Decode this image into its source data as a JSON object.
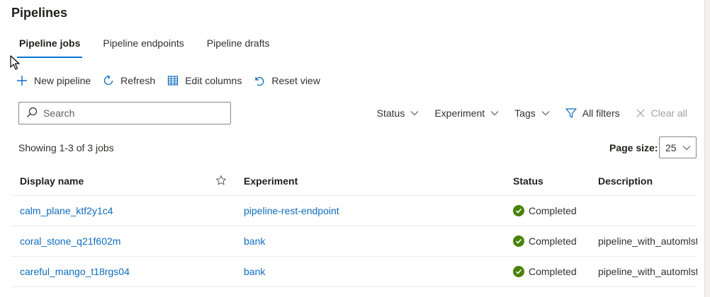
{
  "page": {
    "title": "Pipelines"
  },
  "tabs": [
    {
      "label": "Pipeline jobs",
      "active": true
    },
    {
      "label": "Pipeline endpoints",
      "active": false
    },
    {
      "label": "Pipeline drafts",
      "active": false
    }
  ],
  "toolbar": {
    "new_pipeline": "New pipeline",
    "refresh": "Refresh",
    "edit_columns": "Edit columns",
    "reset_view": "Reset view"
  },
  "search": {
    "placeholder": "Search",
    "value": ""
  },
  "filters": {
    "status": "Status",
    "experiment": "Experiment",
    "tags": "Tags",
    "all_filters": "All filters",
    "clear_all": "Clear all"
  },
  "summary": {
    "showing": "Showing 1-3 of 3 jobs"
  },
  "page_size": {
    "label": "Page size:",
    "value": "25"
  },
  "table": {
    "headers": {
      "display_name": "Display name",
      "experiment": "Experiment",
      "status": "Status",
      "description": "Description"
    },
    "rows": [
      {
        "display_name": "calm_plane_ktf2y1c4",
        "experiment": "pipeline-rest-endpoint",
        "status": "Completed",
        "description": ""
      },
      {
        "display_name": "coral_stone_q21f602m",
        "experiment": "bank",
        "status": "Completed",
        "description": "pipeline_with_automlst..."
      },
      {
        "display_name": "careful_mango_t18rgs04",
        "experiment": "bank",
        "status": "Completed",
        "description": "pipeline_with_automlst..."
      }
    ]
  },
  "colors": {
    "accent": "#0078d4",
    "link": "#0f6cbd",
    "status_completed": "#498205"
  },
  "icons": {
    "new_pipeline": "plus-icon",
    "refresh": "refresh-icon",
    "edit_columns": "table-columns-icon",
    "reset_view": "undo-icon",
    "search": "search-icon",
    "all_filters": "funnel-icon",
    "clear_all": "close-icon",
    "favorite": "star-icon",
    "status_completed": "checkmark-circle-icon"
  }
}
